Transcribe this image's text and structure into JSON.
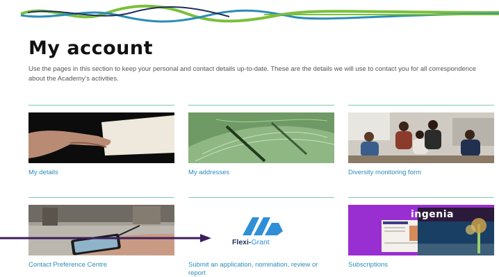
{
  "page": {
    "title": "My account",
    "intro": "Use the pages in this section to keep your personal and contact details up-to-date. These are the details we will use to contact you for all correspondence about the Academy’s activities."
  },
  "cards": [
    {
      "label": "My details"
    },
    {
      "label": "My addresses"
    },
    {
      "label": "Diversity monitoring form"
    },
    {
      "label": "Contact Preference Centre"
    },
    {
      "label": "Submit an application, nomination, review or report"
    },
    {
      "label": "Subscriptions"
    }
  ],
  "images": {
    "flexigrant_brand": "Flexi-",
    "flexigrant_brand_suffix": "Grant",
    "ingenia_brand": "ingenia"
  },
  "colors": {
    "link": "#2a8cb8",
    "rule": "#7dc9b5",
    "arrow": "#3d1d5c",
    "ingenia_bg": "#9a2fd1"
  }
}
